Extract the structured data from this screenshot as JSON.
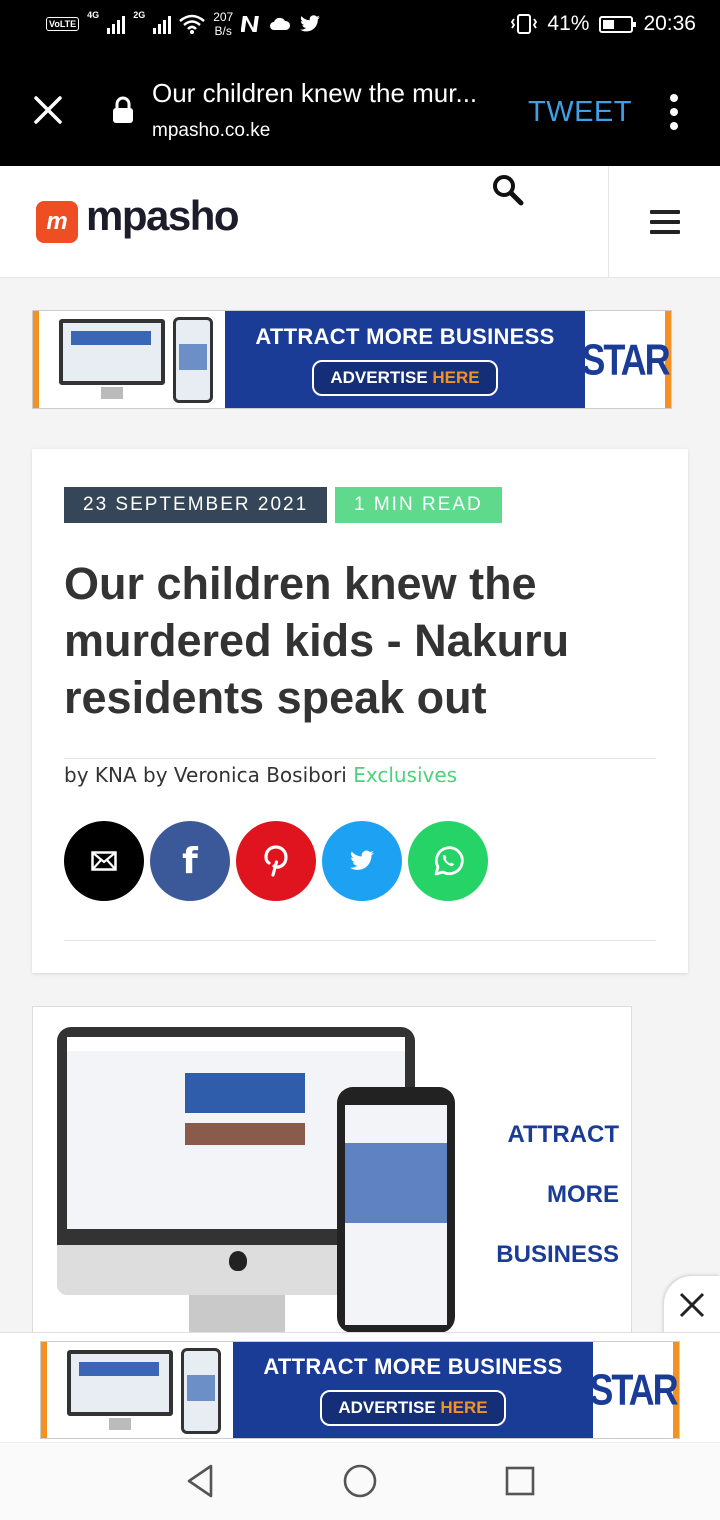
{
  "status_bar": {
    "volte": "VoLTE",
    "network_1": "4G",
    "network_2": "2G",
    "speed_value": "207",
    "speed_unit": "B/s",
    "battery": "41%",
    "time": "20:36",
    "icons": [
      "signal-icon",
      "wifi-icon",
      "netflix-icon",
      "cloud-icon",
      "twitter-icon",
      "vibrate-icon",
      "battery-icon"
    ]
  },
  "browser": {
    "page_title": "Our children knew the mur...",
    "domain": "mpasho.co.ke",
    "tweet_label": "TWEET",
    "icons": [
      "close-icon",
      "lock-icon",
      "more-vert-icon"
    ]
  },
  "site": {
    "logo_mark": "m",
    "logo_text": "mpasho",
    "brand_color": "#ef4d24",
    "icons": [
      "search-icon",
      "menu-icon"
    ]
  },
  "top_banner": {
    "headline": "ATTRACT MORE BUSINESS",
    "button_text": "ADVERTISE",
    "button_highlight": "HERE",
    "brand": "STAR"
  },
  "article": {
    "date": "23 SEPTEMBER 2021",
    "read_time": "1 MIN READ",
    "title": "Our children knew the murdered kids - Nakuru residents speak out",
    "byline": "by KNA by Veronica Bosibori",
    "category": "Exclusives",
    "share_icons": [
      "mail-icon",
      "facebook-icon",
      "pinterest-icon",
      "twitter-icon",
      "whatsapp-icon"
    ],
    "date_badge_color": "#344658",
    "read_badge_color": "#5fd98b"
  },
  "big_ad": {
    "line1": "ATTRACT",
    "line2": "MORE",
    "line3": "BUSINESS"
  },
  "sticky_ad": {
    "headline": "ATTRACT MORE BUSINESS",
    "button_text": "ADVERTISE",
    "button_highlight": "HERE",
    "brand": "STAR"
  },
  "nav": {
    "icons": [
      "back-icon",
      "home-icon",
      "recents-icon"
    ]
  }
}
